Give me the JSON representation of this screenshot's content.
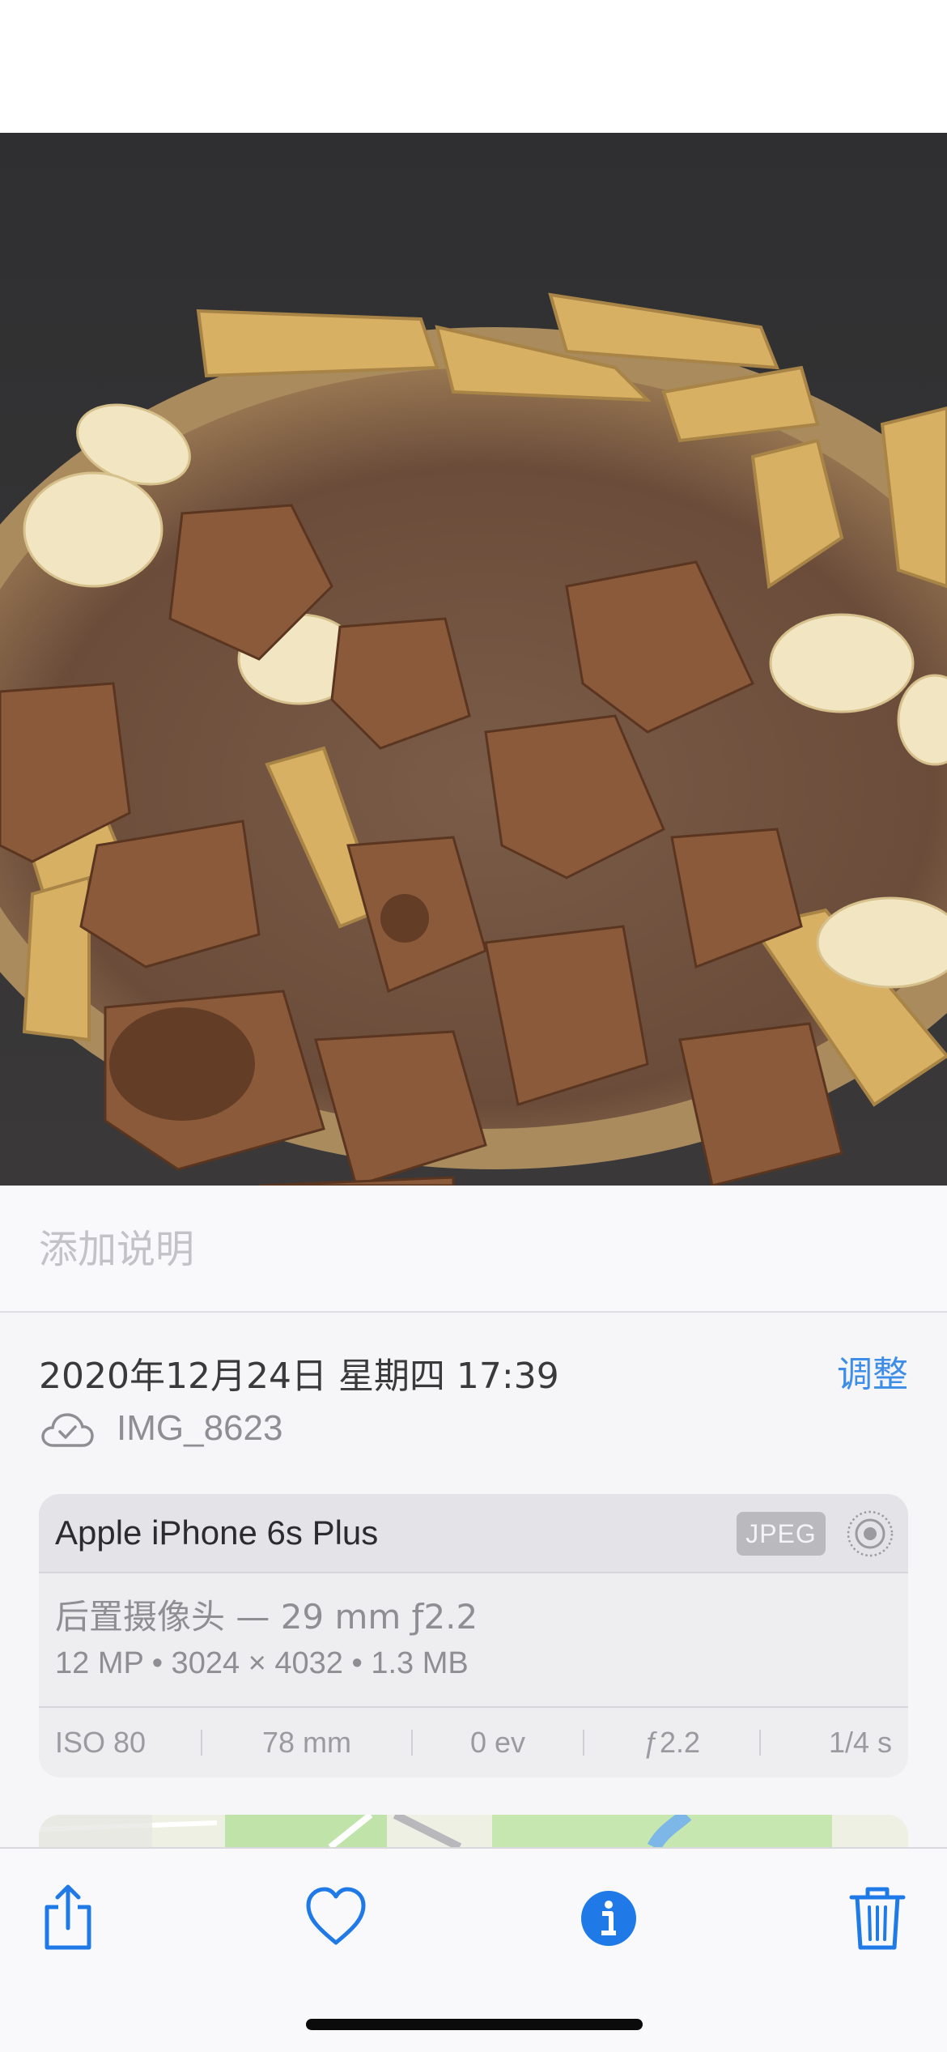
{
  "photo": {
    "description_icon": "photo-of-braised-pork-ribs"
  },
  "caption": {
    "placeholder": "添加说明"
  },
  "info": {
    "datetime": "2020年12月24日 星期四 17:39",
    "adjust_label": "调整",
    "cloud_icon": "cloud-checkmark-icon",
    "filename": "IMG_8623"
  },
  "camera": {
    "device": "Apple iPhone 6s Plus",
    "format_badge": "JPEG",
    "live_icon": "live-photo-icon",
    "lens": "后置摄像头 — 29 mm ƒ2.2",
    "specs": "12 MP  •  3024 × 4032  •  1.3 MB",
    "exif": [
      "ISO 80",
      "78 mm",
      "0 ev",
      "ƒ2.2",
      "1/4 s"
    ]
  },
  "toolbar": {
    "share_icon": "share-icon",
    "favorite_icon": "heart-icon",
    "info_icon": "info-icon",
    "delete_icon": "trash-icon"
  },
  "colors": {
    "accent": "#1f7ae8",
    "adjust_link": "#3e8ee8",
    "text_secondary": "#8e8e93"
  }
}
